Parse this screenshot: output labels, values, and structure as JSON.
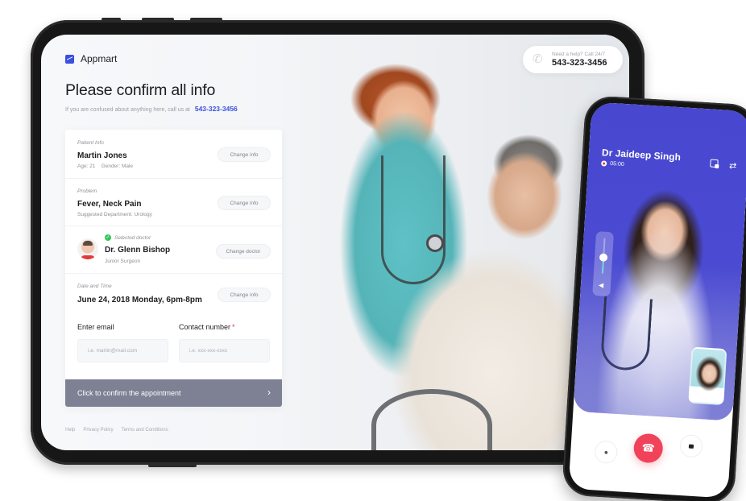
{
  "tablet": {
    "brand": {
      "name": "Appmart",
      "icon": "chart-logo-icon",
      "color": "#3b4fe0"
    },
    "help": {
      "icon": "phone-icon",
      "caption": "Need a help? Call 24/7",
      "number": "543-323-3456"
    },
    "title": "Please confirm all info",
    "subtitle": {
      "text": "If you are confused about anything here, call us at",
      "phone": "543-323-3456"
    },
    "card": {
      "patient": {
        "label": "Patient Info",
        "name": "Martin Jones",
        "age": "Age: 21",
        "gender": "Gender: Male",
        "button": "Change info"
      },
      "problem": {
        "label": "Problem",
        "value": "Fever, Neck Pain",
        "department": "Suggested Department: Urology",
        "button": "Change info"
      },
      "doctor": {
        "label": "Selected doctor",
        "name": "Dr. Glenn Bishop",
        "role": "Junior Surgeon",
        "button": "Change doctor",
        "check_color": "#34c759"
      },
      "datetime": {
        "label": "Date and Time",
        "value": "June 24, 2018 Monday, 6pm-8pm",
        "button": "Change info"
      },
      "email": {
        "label": "Enter email",
        "placeholder": "i.e. martin@mail.com",
        "value": ""
      },
      "contact": {
        "label": "Contact number",
        "required_mark": "*",
        "placeholder": "i.e. xxx-xxx-xxxx",
        "value": ""
      },
      "confirm": {
        "label": "Click to confirm the appointment",
        "chevron": "›",
        "color": "#7d8193"
      }
    },
    "footer": [
      "Help",
      "Privacy Policy",
      "Terms and Conditions"
    ]
  },
  "phone": {
    "caller": "Dr Jaideep Singh",
    "call_time": "05:00",
    "accent": "#4747d0",
    "end_call_color": "#f0435a",
    "volume_level": 0.45,
    "icons": {
      "pip": "picture-in-picture-icon",
      "switch": "switch-camera-icon",
      "speaker": "speaker-icon",
      "mic": "microphone-icon",
      "end": "end-call-icon",
      "camera": "camera-icon"
    },
    "speaker_glyph": "◀",
    "switch_glyph": "⇄",
    "mic_glyph": "🎙",
    "end_glyph": "☎"
  }
}
